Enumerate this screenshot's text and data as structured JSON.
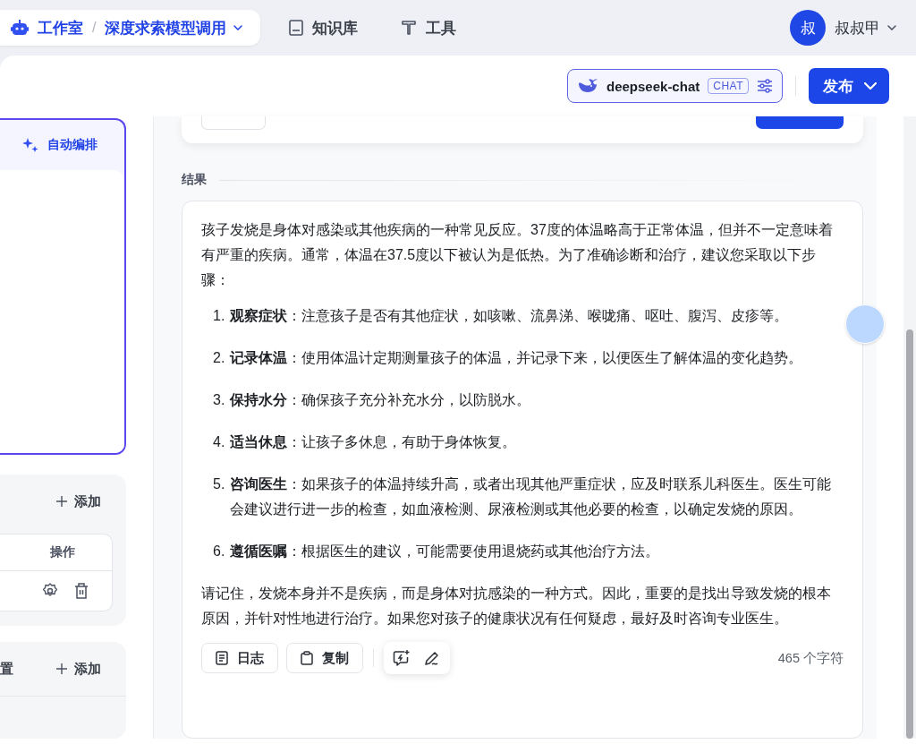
{
  "breadcrumb": {
    "root": "工作室",
    "separator": "/",
    "current": "深度求索模型调用"
  },
  "nav": [
    {
      "label": "知识库",
      "kind": "knowledge"
    },
    {
      "label": "工具",
      "kind": "tools"
    }
  ],
  "user": {
    "avatar_letter": "叔",
    "name": "叔叔甲"
  },
  "model": {
    "name": "deepseek-chat",
    "tag": "CHAT"
  },
  "publish": {
    "label": "发布"
  },
  "left": {
    "auto_arrange": "自动编排",
    "variables": {
      "add": "添加",
      "table_header": "操作"
    },
    "settings": {
      "title": "置",
      "add": "添加"
    }
  },
  "result": {
    "label": "结果",
    "intro": "孩子发烧是身体对感染或其他疾病的一种常见反应。37度的体温略高于正常体温，但并不一定意味着有严重的疾病。通常，体温在37.5度以下被认为是低热。为了准确诊断和治疗，建议您采取以下步骤：",
    "steps": [
      {
        "number": "1.",
        "text": "**观察症状**：注意孩子是否有其他症状，如咳嗽、流鼻涕、喉咙痛、呕吐、腹泻、皮疹等。"
      },
      {
        "number": "2.",
        "text": "**记录体温**：使用体温计定期测量孩子的体温，并记录下来，以便医生了解体温的变化趋势。"
      },
      {
        "number": "3.",
        "text": "**保持水分**：确保孩子充分补充水分，以防脱水。"
      },
      {
        "number": "4.",
        "text": "**适当休息**：让孩子多休息，有助于身体恢复。"
      },
      {
        "number": "5.",
        "text": "**咨询医生**：如果孩子的体温持续升高，或者出现其他严重症状，应及时联系儿科医生。医生可能会建议进行进一步的检查，如血液检测、尿液检测或其他必要的检查，以确定发烧的原因。"
      },
      {
        "number": "6.",
        "text": "**遵循医嘱**：根据医生的建议，可能需要使用退烧药或其他治疗方法。"
      }
    ],
    "closing": "请记住，发烧本身并不是疾病，而是身体对抗感染的一种方式。因此，重要的是找出导致发烧的根本原因，并针对性地进行治疗。如果您对孩子的健康状况有任何疑虑，最好及时咨询专业医生。",
    "actions": [
      {
        "label": "日志",
        "kind": "log"
      },
      {
        "label": "复制",
        "kind": "copy"
      }
    ],
    "char_count": "465 个字符"
  }
}
